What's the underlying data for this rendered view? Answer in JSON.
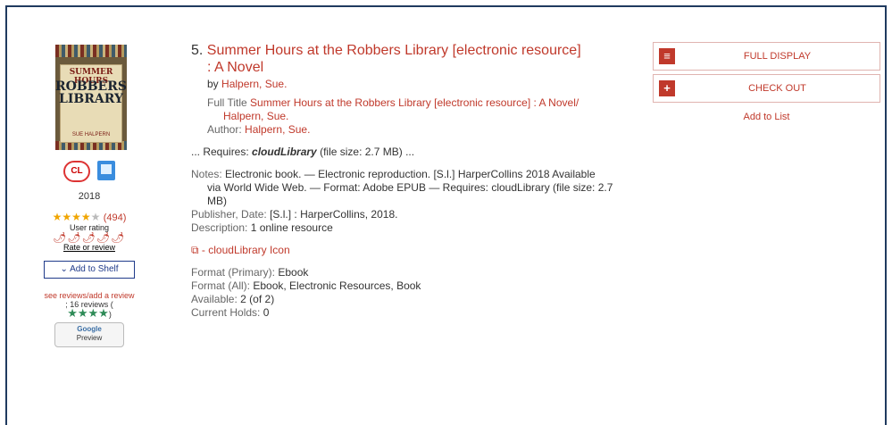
{
  "record": {
    "number": "5.",
    "title_line1": "Summer Hours at the Robbers Library [electronic resource]",
    "title_line2": ": A Novel",
    "by_label": "by",
    "by_author": "Halpern, Sue.",
    "full_title_label": "Full Title",
    "full_title_value1": "Summer Hours at the Robbers Library [electronic resource] : A Novel/",
    "full_title_value2": "Halpern, Sue.",
    "author_label": "Author:",
    "author_value": "Halpern, Sue.",
    "requires_pre": "... Requires:",
    "requires_bold": "cloudLibrary",
    "requires_post": "(file size: 2.7 MB) ...",
    "notes_label": "Notes:",
    "notes_line1": "Electronic book. — Electronic reproduction. [S.l.] HarperCollins 2018 Available",
    "notes_line2": "via World Wide Web. — Format: Adobe EPUB — Requires: cloudLibrary (file size: 2.7",
    "notes_line3": "MB)",
    "publisher_label": "Publisher, Date:",
    "publisher_value": "[S.l.] : HarperCollins, 2018.",
    "description_label": "Description:",
    "description_value": "1 online resource",
    "cloud_link": "- cloudLibrary Icon",
    "format_primary_label": "Format (Primary):",
    "format_primary_value": "Ebook",
    "format_all_label": "Format (All):",
    "format_all_value": "Ebook, Electronic Resources, Book",
    "available_label": "Available:",
    "available_value": "2 (of 2)",
    "holds_label": "Current Holds:",
    "holds_value": "0"
  },
  "cover": {
    "line1": "SUMMER HOURS",
    "line2a": "ROBBERS",
    "line2b": "LIBRARY",
    "line3": "SUE HALPERN"
  },
  "sidebar": {
    "cl_icon_text": "CL",
    "year": "2018",
    "rating_count": "(494)",
    "rating_value": 3.5,
    "user_rating_label": "User rating",
    "peppers": "ꜙꜙꜙꜙꜙ",
    "rate_link": "Rate or review",
    "add_to_shelf": "Add to Shelf",
    "reviews_link": "see reviews/add a review",
    "reviews_text": "; 16 reviews (",
    "reviews_stars": "★★★★",
    "reviews_close": ")",
    "google_line1": "Google",
    "google_line2": "Preview"
  },
  "actions": {
    "full_display": "FULL DISPLAY",
    "check_out": "CHECK OUT",
    "add_to_list": "Add to List"
  },
  "colors": {
    "accent": "#c0392b",
    "frame": "#1f3a5f",
    "shelf_button": "#1f3a8a"
  }
}
